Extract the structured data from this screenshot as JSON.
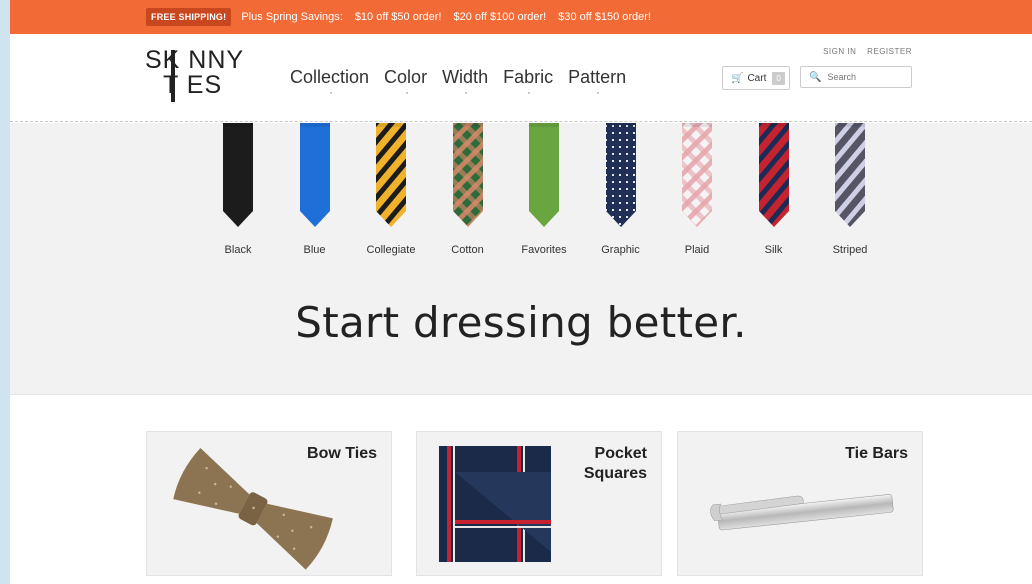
{
  "promo": {
    "badge": "FREE SHIPPING!",
    "lead": "Plus Spring Savings:",
    "offers": [
      "$10 off $50 order!",
      "$20 off $100 order!",
      "$30 off $150 order!"
    ]
  },
  "logo": {
    "line1": "SK NNY",
    "line2": "T ES"
  },
  "nav": [
    "Collection",
    "Color",
    "Width",
    "Fabric",
    "Pattern"
  ],
  "account": {
    "sign_in": "SIGN IN",
    "register": "REGISTER"
  },
  "cart": {
    "label": "Cart",
    "count": "0"
  },
  "search": {
    "placeholder": "Search"
  },
  "ties": [
    {
      "label": "Black",
      "color": "#1c1c1c"
    },
    {
      "label": "Blue",
      "color": "#1f6fd9"
    },
    {
      "label": "Collegiate",
      "color": "#f0b22b"
    },
    {
      "label": "Cotton",
      "color": "#d98a6a"
    },
    {
      "label": "Favorites",
      "color": "#6aa63f"
    },
    {
      "label": "Graphic",
      "color": "#1f2f55"
    },
    {
      "label": "Plaid",
      "color": "#e6a3aa"
    },
    {
      "label": "Silk",
      "color": "#c4232f"
    },
    {
      "label": "Striped",
      "color": "#555566"
    }
  ],
  "headline": "Start dressing better.",
  "cards": [
    {
      "title": "Bow Ties"
    },
    {
      "title_l1": "Pocket",
      "title_l2": "Squares"
    },
    {
      "title": "Tie Bars"
    }
  ],
  "colors": {
    "promo": "#f26a35",
    "band": "#f2f2f2"
  }
}
